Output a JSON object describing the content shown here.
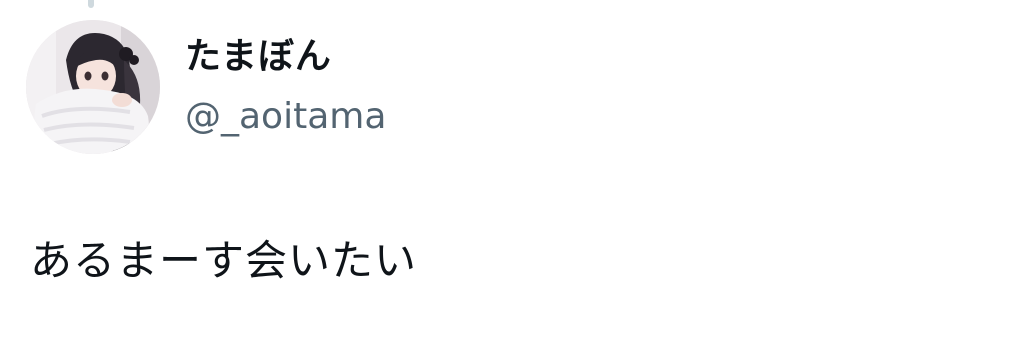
{
  "tweet": {
    "author": {
      "display_name": "たまぼん",
      "handle": "@_aoitama",
      "avatar": "profile-photo"
    },
    "text": "あるまーす会いたい"
  },
  "colors": {
    "name": "#0f1419",
    "handle": "#536471",
    "thread_line": "#cfd9de",
    "background": "#ffffff"
  }
}
